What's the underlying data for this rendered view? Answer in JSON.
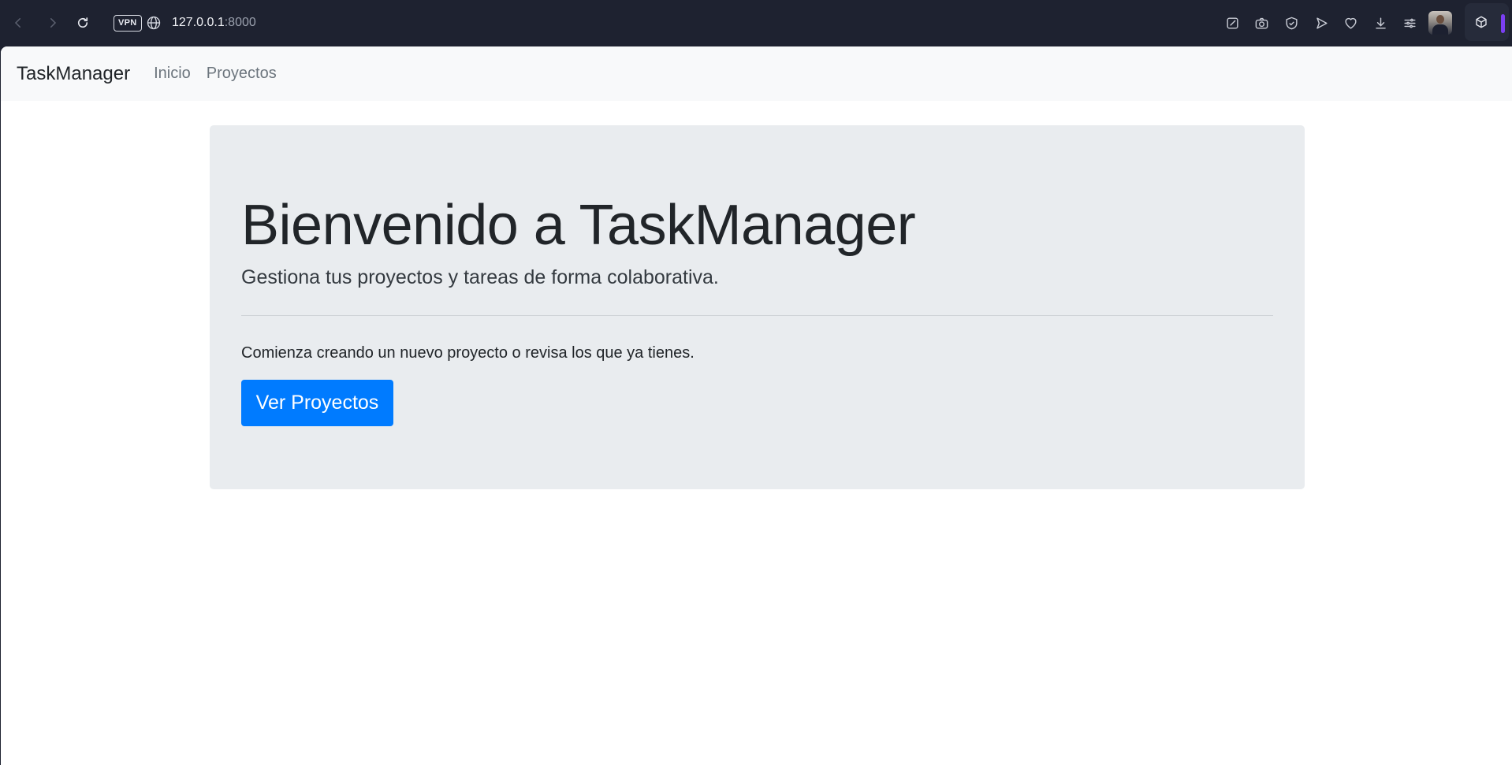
{
  "browser": {
    "vpn_label": "VPN",
    "url_host": "127.0.0.1",
    "url_port": ":8000",
    "icons": [
      "back-icon",
      "forward-icon",
      "reload-icon",
      "globe-icon",
      "snapshot-edit-icon",
      "camera-icon",
      "shield-icon",
      "send-icon",
      "heart-icon",
      "download-icon",
      "settings-icon",
      "extension-cube-icon"
    ]
  },
  "navbar": {
    "brand": "TaskManager",
    "links": [
      "Inicio",
      "Proyectos"
    ]
  },
  "hero": {
    "title": "Bienvenido a TaskManager",
    "lead": "Gestiona tus proyectos y tareas de forma colaborativa.",
    "text": "Comienza creando un nuevo proyecto o revisa los que ya tienes.",
    "button_label": "Ver Proyectos"
  },
  "colors": {
    "chrome": "#1e2230",
    "navbar_bg": "#f8f9fa",
    "jumbotron_bg": "#e9ecef",
    "primary": "#007bff",
    "accent": "#7b3ff2"
  }
}
